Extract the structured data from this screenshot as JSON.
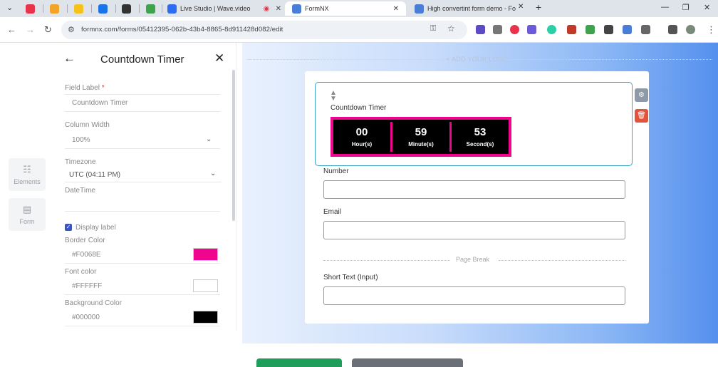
{
  "browser": {
    "tabs": [
      {
        "label": "",
        "color": "#e8334a"
      },
      {
        "label": "",
        "color": "#f2a428"
      },
      {
        "label": "",
        "color": "#f5c21b"
      },
      {
        "label": "",
        "color": "#1a73e8"
      },
      {
        "label": "",
        "color": "#333333"
      },
      {
        "label": "",
        "color": "#3fa34d"
      },
      {
        "label": "Live Studio | Wave.video",
        "color": "#2f6bf0"
      },
      {
        "label": "FormNX",
        "color": "#4a7dd6"
      },
      {
        "label": "High convertint form demo - Fo",
        "color": "#4a7dd6"
      }
    ],
    "new_tab": "+",
    "url": "formnx.com/forms/05412395-062b-43b4-8865-8d911428d082/edit"
  },
  "rail": {
    "elements_label": "Elements",
    "form_label": "Form"
  },
  "panel": {
    "title": "Countdown Timer",
    "field_label": "Field Label",
    "field_label_req": "*",
    "field_value": "Countdown Timer",
    "column_width_label": "Column Width",
    "column_width_value": "100%",
    "timezone_label": "Timezone",
    "timezone_value": "UTC (04:11 PM)",
    "datetime_label": "DateTime",
    "display_label": "Display label",
    "display_label_checked": true,
    "border_color_label": "Border Color",
    "border_color_value": "#F0068E",
    "font_color_label": "Font color",
    "font_color_value": "#FFFFFF",
    "bg_color_label": "Background Color",
    "bg_color_value": "#000000"
  },
  "canvas": {
    "add_logo": "+ ADD YOUR LOGO",
    "countdown_label": "Countdown Timer",
    "timer": [
      {
        "value": "00",
        "unit": "Hour(s)"
      },
      {
        "value": "59",
        "unit": "Minute(s)"
      },
      {
        "value": "53",
        "unit": "Second(s)"
      }
    ],
    "fields": {
      "number": "Number",
      "email": "Email",
      "page_break": "Page Break",
      "short_text": "Short Text (Input)"
    }
  },
  "colors": {
    "accent": "#F0068E",
    "select_border": "#3aa2c9",
    "delete_red": "#e5533b",
    "settings_grey": "#8e9aa8",
    "checkbox_blue": "#3b54c4"
  }
}
